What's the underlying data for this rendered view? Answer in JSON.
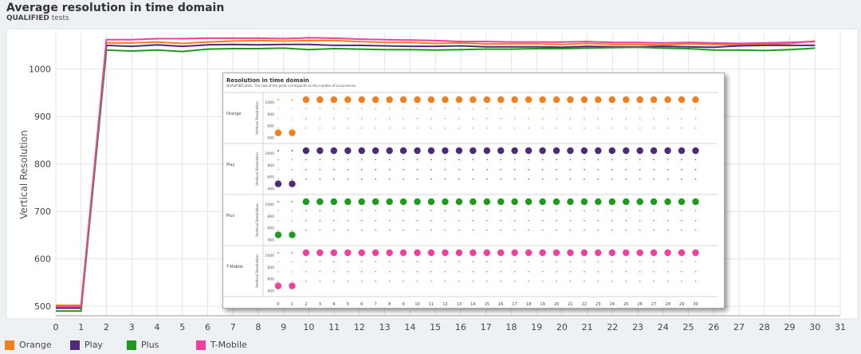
{
  "header": {
    "title": "Average resolution in time domain",
    "subtitle_strong": "QUALIFIED",
    "subtitle_rest": " tests"
  },
  "chart_data": [
    {
      "type": "line",
      "title": "Average resolution in time domain",
      "subtitle": "QUALIFIED tests",
      "xlabel": "",
      "ylabel": "Vertical Resolution",
      "x": [
        0,
        1,
        2,
        3,
        4,
        5,
        6,
        7,
        8,
        9,
        10,
        11,
        12,
        13,
        14,
        15,
        16,
        17,
        18,
        19,
        20,
        21,
        22,
        23,
        24,
        25,
        26,
        27,
        28,
        29,
        30
      ],
      "xticks": [
        0,
        1,
        2,
        3,
        4,
        5,
        6,
        7,
        8,
        9,
        10,
        11,
        12,
        13,
        14,
        15,
        16,
        17,
        18,
        19,
        20,
        21,
        22,
        23,
        24,
        25,
        26,
        27,
        28,
        29,
        30,
        31
      ],
      "yticks": [
        500,
        600,
        700,
        800,
        900,
        1000
      ],
      "xlim": [
        0,
        31
      ],
      "ylim": [
        480,
        1075
      ],
      "grid": true,
      "legend": "bottom-left",
      "series": [
        {
          "name": "Orange",
          "color": "#f07f1d",
          "values": [
            502,
            502,
            1055,
            1055,
            1057,
            1054,
            1057,
            1059,
            1060,
            1059,
            1060,
            1060,
            1058,
            1056,
            1056,
            1054,
            1055,
            1053,
            1053,
            1053,
            1052,
            1054,
            1052,
            1052,
            1051,
            1053,
            1052,
            1051,
            1052,
            1054,
            1059
          ]
        },
        {
          "name": "Play",
          "color": "#4d2a7a",
          "values": [
            496,
            496,
            1050,
            1048,
            1051,
            1048,
            1051,
            1052,
            1051,
            1052,
            1052,
            1050,
            1050,
            1049,
            1048,
            1048,
            1049,
            1047,
            1047,
            1047,
            1046,
            1048,
            1047,
            1047,
            1048,
            1047,
            1046,
            1049,
            1050,
            1050,
            1050
          ]
        },
        {
          "name": "Plus",
          "color": "#1f9a1f",
          "values": [
            490,
            490,
            1040,
            1038,
            1040,
            1037,
            1042,
            1043,
            1043,
            1044,
            1041,
            1043,
            1042,
            1041,
            1041,
            1040,
            1041,
            1042,
            1042,
            1043,
            1043,
            1044,
            1045,
            1046,
            1044,
            1043,
            1040,
            1040,
            1039,
            1041,
            1044
          ]
        },
        {
          "name": "T-Mobile",
          "color": "#ef3f9f",
          "values": [
            499,
            499,
            1062,
            1062,
            1064,
            1064,
            1065,
            1065,
            1065,
            1064,
            1066,
            1065,
            1063,
            1062,
            1061,
            1060,
            1058,
            1058,
            1057,
            1057,
            1057,
            1058,
            1056,
            1056,
            1055,
            1056,
            1055,
            1054,
            1055,
            1056,
            1058
          ]
        }
      ]
    },
    {
      "type": "scatter",
      "title": "Resolution in time domain",
      "subtitle": "QUALIFIED tests, The size of the point corresponds to the number of occurrences",
      "ylabel": "Vertical Resolution",
      "x": [
        0,
        1,
        2,
        3,
        4,
        5,
        6,
        7,
        8,
        9,
        10,
        11,
        12,
        13,
        14,
        15,
        16,
        17,
        18,
        19,
        20,
        21,
        22,
        23,
        24,
        25,
        26,
        27,
        28,
        29,
        30
      ],
      "yticks": [
        400,
        600,
        800,
        1000
      ],
      "ylim": [
        380,
        1080
      ],
      "panels": [
        {
          "name": "Orange",
          "color": "#f07f1d"
        },
        {
          "name": "Play",
          "color": "#4d2a7a"
        },
        {
          "name": "Plus",
          "color": "#1f9a1f"
        },
        {
          "name": "T-Mobile",
          "color": "#ef3f9f"
        }
      ]
    }
  ]
}
